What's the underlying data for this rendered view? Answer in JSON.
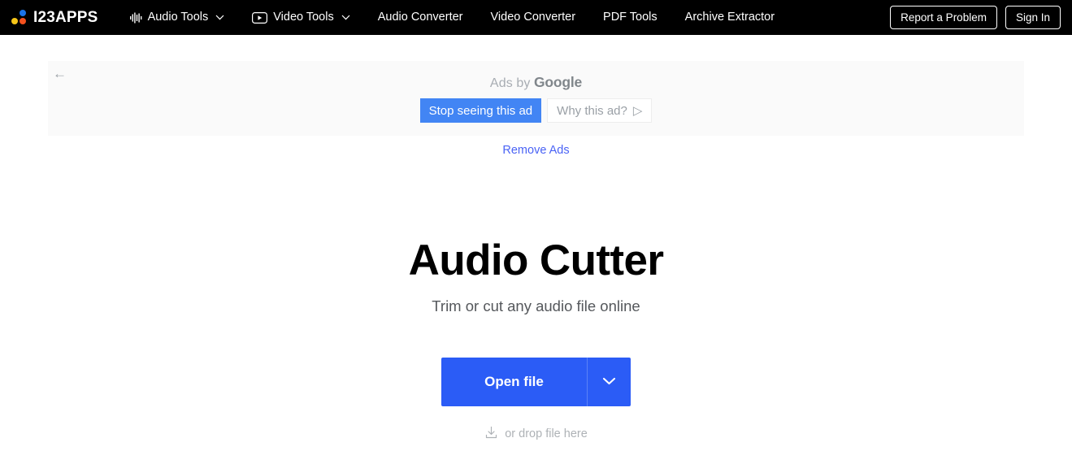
{
  "navbar": {
    "brand": "I23APPS",
    "items": [
      {
        "label": "Audio Tools",
        "icon": "waveform-icon",
        "caret": "⌄"
      },
      {
        "label": "Video Tools",
        "icon": "video-play-icon",
        "caret": "⌄"
      },
      {
        "label": "Audio Converter",
        "icon": null,
        "caret": null
      },
      {
        "label": "Video Converter",
        "icon": null,
        "caret": null
      },
      {
        "label": "PDF Tools",
        "icon": null,
        "caret": null
      },
      {
        "label": "Archive Extractor",
        "icon": null,
        "caret": null
      }
    ],
    "report_button": "Report a Problem",
    "signin_button": "Sign In"
  },
  "ad": {
    "back_icon": "←",
    "ads_by_prefix": "Ads by ",
    "ads_by_brand": "Google",
    "stop_button": "Stop seeing this ad",
    "why_button": "Why this ad?",
    "why_icon": "▷",
    "remove_ads_link": "Remove Ads"
  },
  "hero": {
    "title": "Audio Cutter",
    "subtitle": "Trim or cut any audio file online",
    "open_file_button": "Open file",
    "caret_icon": "chevron-down-icon",
    "drop_text": "or drop file here",
    "drop_icon": "download-icon"
  },
  "colors": {
    "navbar_bg": "#000000",
    "primary_blue": "#2b5cf6",
    "google_blue": "#4285f4",
    "link_blue": "#4a63f5",
    "ad_bg": "#fafafa",
    "logo_blue": "#1a73e8",
    "logo_yellow": "#f5c518",
    "logo_red": "#f4511e"
  }
}
